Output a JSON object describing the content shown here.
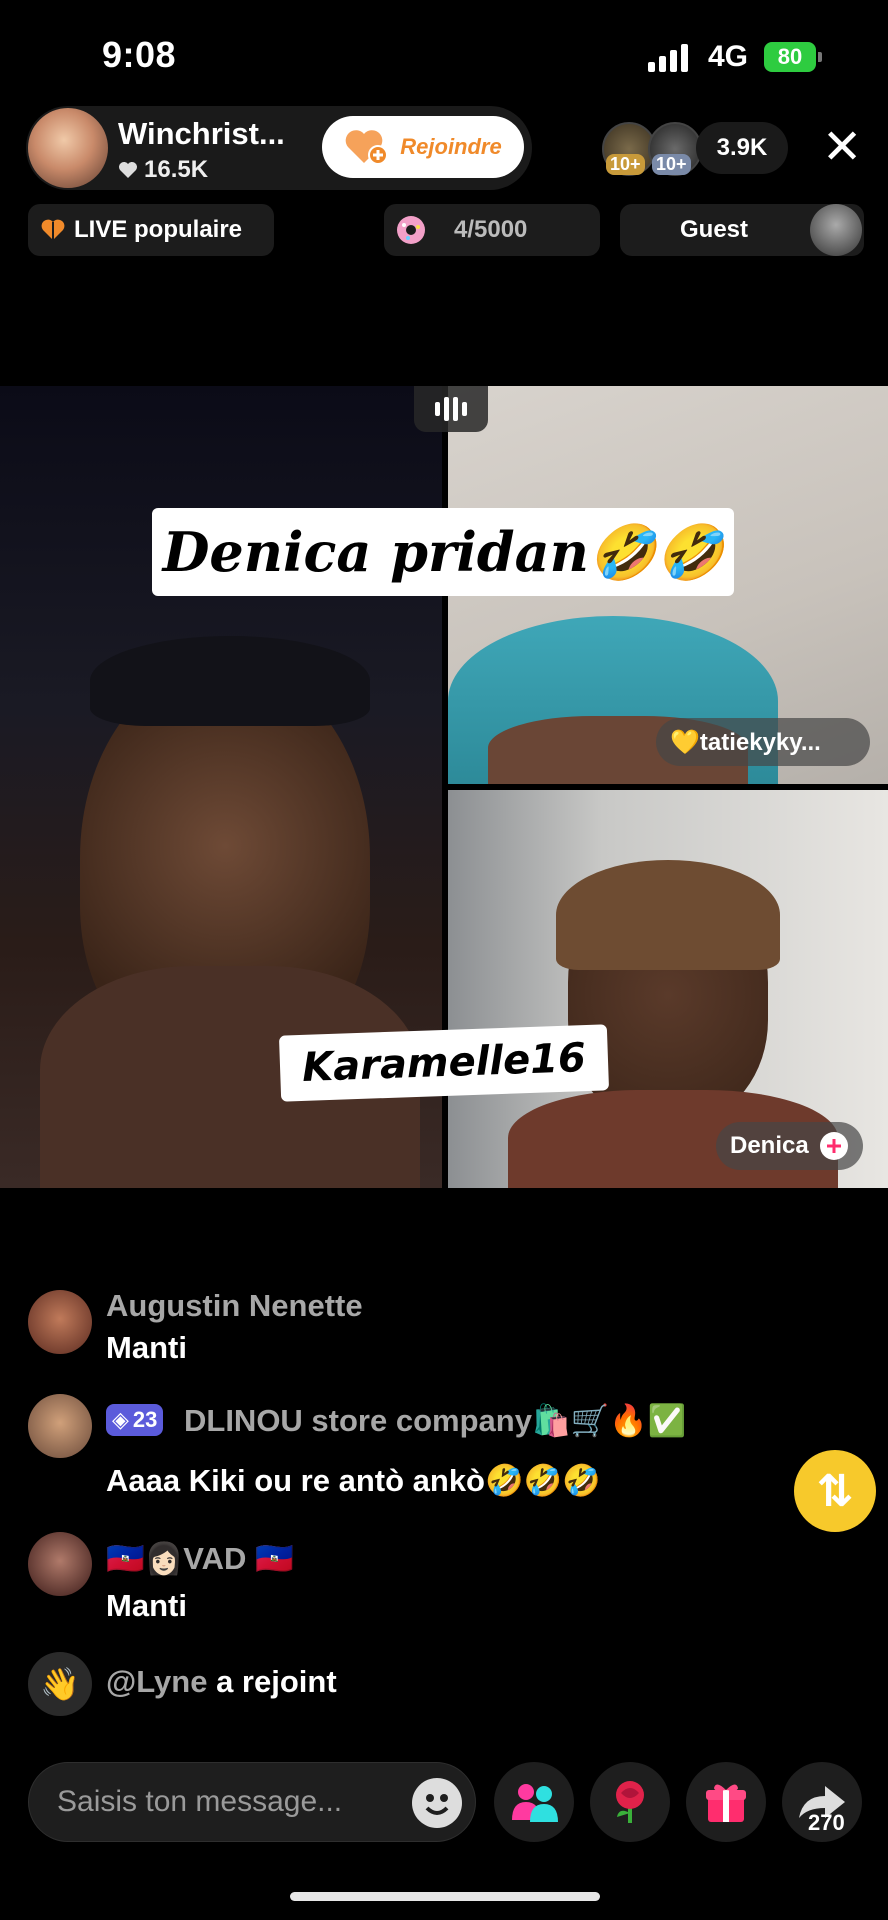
{
  "status": {
    "time": "9:08",
    "network": "4G",
    "battery": "80"
  },
  "host": {
    "name": "Winchrist...",
    "likes": "16.5K",
    "join_label": "Rejoindre"
  },
  "viewers": {
    "badge1": "10+",
    "badge2": "10+",
    "count": "3.9K"
  },
  "info_row": {
    "popular_label": "LIVE populaire",
    "gift_progress": "4/5000",
    "guest_label": "Guest"
  },
  "video": {
    "banner_top": "Denica pridan🤣🤣",
    "banner_bottom": "Karamelle16",
    "guest_top_name": "💛tatiekyky...",
    "guest_bottom_name": "Denica"
  },
  "chat": [
    {
      "user": "Augustin Nenette",
      "message": "Manti"
    },
    {
      "badge_level": "23",
      "user": "DLINOU store company🛍️🛒🔥✅",
      "message": "Aaaa Kiki ou re antò ankò🤣🤣🤣"
    },
    {
      "user": "🇭🇹👩🏻VAD 🇭🇹",
      "message": "Manti"
    }
  ],
  "join_notice": {
    "user": "@Lyne",
    "text": "a rejoint"
  },
  "bottom": {
    "placeholder": "Saisis ton message...",
    "share_count": "270"
  },
  "icons": {
    "join": "heart-plus-icon",
    "close": "close-icon",
    "popular": "heart-icon",
    "gift_progress": "donut-icon",
    "share_fab": "repost-icon",
    "emoji": "emoji-icon",
    "multi_guest": "people-icon",
    "rose": "rose-icon",
    "gift": "gift-icon",
    "share": "share-arrow-icon"
  },
  "colors": {
    "join_text": "#f08a2a",
    "share_fab": "#f7c92b",
    "battery": "#2ecc40",
    "badge": "#6b6bff"
  }
}
